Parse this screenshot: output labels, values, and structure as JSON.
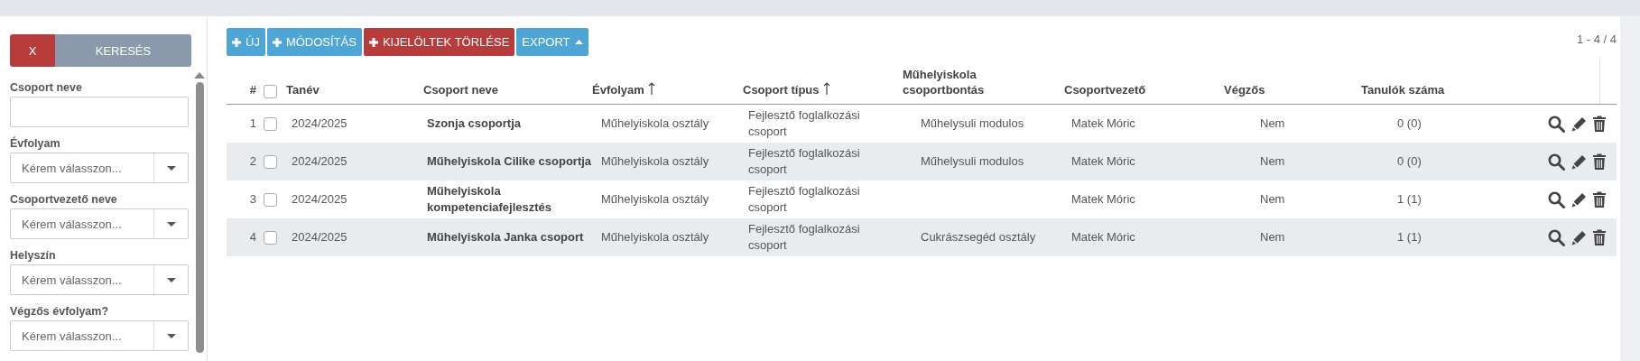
{
  "sidebar": {
    "clear_button": "X",
    "search_button": "KERESÉS",
    "filters": [
      {
        "kind": "text",
        "label": "Csoport neve"
      },
      {
        "kind": "select",
        "label": "Évfolyam",
        "placeholder": "Kérem válasszon..."
      },
      {
        "kind": "select",
        "label": "Csoportvezető neve",
        "placeholder": "Kérem válasszon..."
      },
      {
        "kind": "select",
        "label": "Helyszín",
        "placeholder": "Kérem válasszon..."
      },
      {
        "kind": "select",
        "label": "Végzős évfolyam?",
        "placeholder": "Kérem válasszon..."
      }
    ]
  },
  "toolbar": {
    "buttons": [
      {
        "kind": "add",
        "label": "ÚJ"
      },
      {
        "kind": "add",
        "label": "MÓDOSÍTÁS"
      },
      {
        "kind": "delete",
        "label": "KIJELÖLTEK TÖRLÉSE"
      },
      {
        "kind": "dropdown",
        "label": "EXPORT"
      }
    ],
    "pagination": "1 - 4 / 4"
  },
  "table": {
    "columns": [
      {
        "label": "#",
        "sortable": false
      },
      {
        "label": "Tanév",
        "sortable": false
      },
      {
        "label": "Csoport neve",
        "sortable": false
      },
      {
        "label": "Évfolyam",
        "sortable": true
      },
      {
        "label": "Csoport típus",
        "sortable": true
      },
      {
        "label": "Műhelyiskola csoportbontás",
        "sortable": false
      },
      {
        "label": "Csoportvezető",
        "sortable": false
      },
      {
        "label": "Végzős",
        "sortable": false
      },
      {
        "label": "Tanulók száma",
        "sortable": false
      }
    ],
    "select_all_checked": false,
    "rows": [
      {
        "checked": false,
        "cells": [
          "1",
          "2024/2025",
          "Szonja csoportja",
          "Műhelyiskola osztály",
          "Fejlesztő foglalkozási csoport",
          "Műhelysuli modulos",
          "Matek Móric",
          "Nem",
          "0 (0)"
        ]
      },
      {
        "checked": false,
        "cells": [
          "2",
          "2024/2025",
          "Műhelyiskola Cilike csoportja",
          "Műhelyiskola osztály",
          "Fejlesztő foglalkozási csoport",
          "Műhelysuli modulos",
          "Matek Móric",
          "Nem",
          "0 (0)"
        ]
      },
      {
        "checked": false,
        "cells": [
          "3",
          "2024/2025",
          "Műhelyiskola kompetenciafejlesztés",
          "Műhelyiskola osztály",
          "Fejlesztő foglalkozási csoport",
          "",
          "Matek Móric",
          "Nem",
          "1 (1)"
        ]
      },
      {
        "checked": false,
        "cells": [
          "4",
          "2024/2025",
          "Műhelyiskola Janka csoport",
          "Műhelyiskola osztály",
          "Fejlesztő foglalkozási csoport",
          "Cukrászsegéd osztály",
          "Matek Móric",
          "Nem",
          "1 (1)"
        ]
      }
    ]
  }
}
